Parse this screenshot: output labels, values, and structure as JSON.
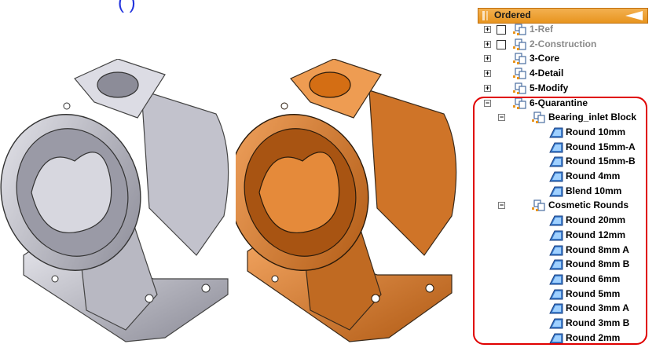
{
  "heading_fragment": "(     )",
  "tree": {
    "header": "Ordered",
    "items": [
      {
        "label": "1-Ref",
        "expander": "+",
        "checkbox": true,
        "gray": true
      },
      {
        "label": "2-Construction",
        "expander": "+",
        "checkbox": true,
        "gray": true
      },
      {
        "label": "3-Core",
        "expander": "+",
        "checkbox": false,
        "gray": false
      },
      {
        "label": "4-Detail",
        "expander": "+",
        "checkbox": false,
        "gray": false
      },
      {
        "label": "5-Modify",
        "expander": "+",
        "checkbox": false,
        "gray": false
      },
      {
        "label": "6-Quarantine",
        "expander": "−",
        "checkbox": false,
        "gray": false
      }
    ],
    "groups": [
      {
        "label": "Bearing_inlet Block",
        "expander": "−",
        "features": [
          "Round 10mm",
          "Round 15mm-A",
          "Round 15mm-B",
          "Round 4mm",
          "Blend 10mm"
        ]
      },
      {
        "label": "Cosmetic Rounds",
        "expander": "−",
        "features": [
          "Round 20mm",
          "Round 12mm",
          "Round 8mm A",
          "Round 8mm B",
          "Round 6mm",
          "Round 5mm",
          "Round 3mm A",
          "Round 3mm B",
          "Round 2mm"
        ]
      }
    ]
  },
  "colors": {
    "header_orange": "#e8951f",
    "highlight_red": "#e00000",
    "model_gray": "#c8c8d0",
    "model_orange": "#d67a2a",
    "feature_icon_blue": "#3d7fd0"
  }
}
